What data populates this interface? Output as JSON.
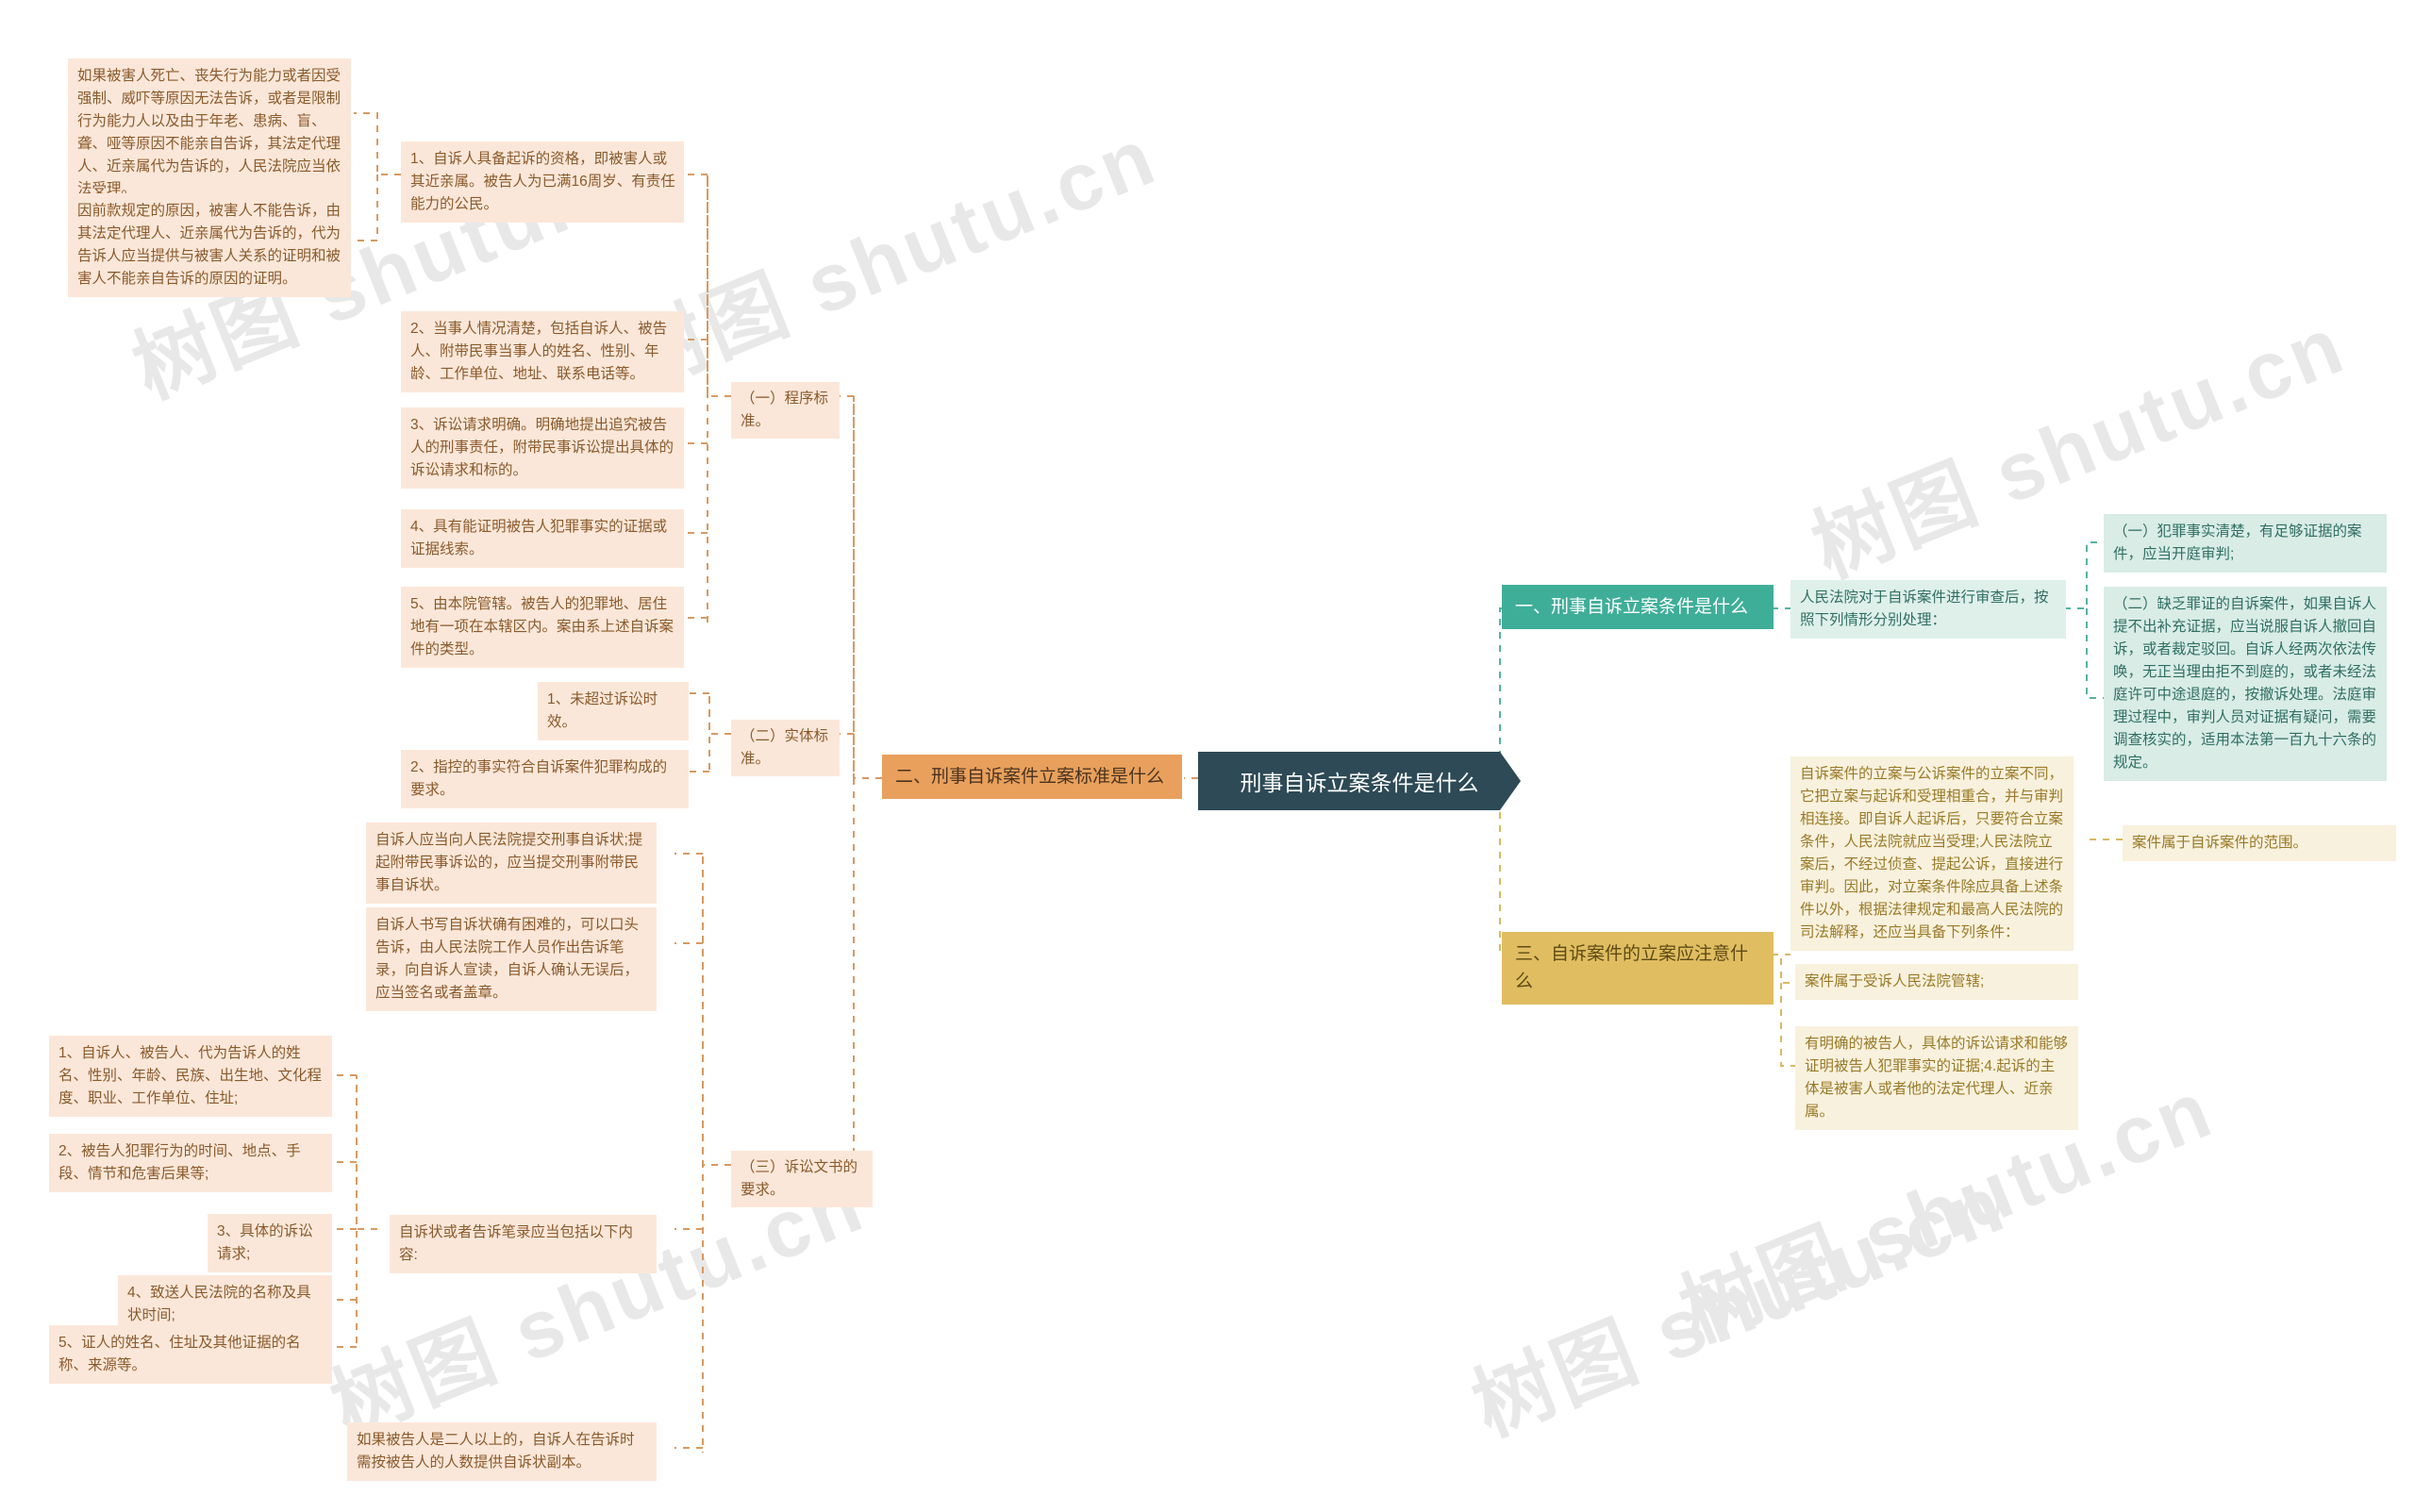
{
  "root": {
    "label": "刑事自诉立案条件是什么"
  },
  "watermarks": [
    "树图 shutu.cn",
    "树图 shutu.cn",
    "树图 shutu.cn",
    "树图 shutu.cn",
    "树图 shutu.cn",
    "树图 shutu.cn"
  ],
  "colors": {
    "root_bg": "#2d4a56",
    "branch_orange": "#e8a05c",
    "branch_mint": "#3fae99",
    "branch_gold": "#e0bd61",
    "leaf_peach": "#fbe7d9",
    "leaf_mint": "#dff0ea",
    "leaf_gold": "#f8f1dd",
    "link_orange": "#d79a62",
    "link_mint": "#55b3a0",
    "link_gold": "#d9b860",
    "text_peach": "#8a5a2b",
    "text_mint": "#2f6f62",
    "text_gold": "#9a7a28"
  },
  "branches": {
    "one": {
      "label": "一、刑事自诉立案条件是什么",
      "intro": "人民法院对于自诉案件进行审查后，按照下列情形分别处理：",
      "items": [
        "（一）犯罪事实清楚，有足够证据的案件，应当开庭审判;",
        "（二）缺乏罪证的自诉案件，如果自诉人提不出补充证据，应当说服自诉人撤回自诉，或者裁定驳回。自诉人经两次依法传唤，无正当理由拒不到庭的，或者未经法庭许可中途退庭的，按撤诉处理。法庭审理过程中，审判人员对证据有疑问，需要调查核实的，适用本法第一百九十六条的规定。"
      ]
    },
    "two": {
      "label": "二、刑事自诉案件立案标准是什么",
      "groups": [
        {
          "label": "（一）程序标准。",
          "items": [
            "1、自诉人具备起诉的资格，即被害人或其近亲属。被告人为已满16周岁、有责任能力的公民。",
            "2、当事人情况清楚，包括自诉人、被告人、附带民事当事人的姓名、性别、年龄、工作单位、地址、联系电话等。",
            "3、诉讼请求明确。明确地提出追究被告人的刑事责任，附带民事诉讼提出具体的诉讼请求和标的。",
            "4、具有能证明被告人犯罪事实的证据或证据线索。",
            "5、由本院管辖。被告人的犯罪地、居住地有一项在本辖区内。案由系上述自诉案件的类型。"
          ],
          "sub_of_item1": [
            "如果被害人死亡、丧失行为能力或者因受强制、威吓等原因无法告诉，或者是限制行为能力人以及由于年老、患病、盲、聋、哑等原因不能亲自告诉，其法定代理人、近亲属代为告诉的，人民法院应当依法受理。",
            "因前款规定的原因，被害人不能告诉，由其法定代理人、近亲属代为告诉的，代为告诉人应当提供与被害人关系的证明和被害人不能亲自告诉的原因的证明。"
          ]
        },
        {
          "label": "（二）实体标准。",
          "items": [
            "1、未超过诉讼时效。",
            "2、指控的事实符合自诉案件犯罪构成的要求。"
          ]
        },
        {
          "label": "（三）诉讼文书的要求。",
          "items": [
            "自诉人应当向人民法院提交刑事自诉状;提起附带民事诉讼的，应当提交刑事附带民事自诉状。",
            "自诉人书写自诉状确有困难的，可以口头告诉，由人民法院工作人员作出告诉笔录，向自诉人宣读，自诉人确认无误后，应当签名或者盖章。",
            "自诉状或者告诉笔录应当包括以下内容:",
            "如果被告人是二人以上的，自诉人在告诉时需按被告人的人数提供自诉状副本。"
          ],
          "contents": [
            "1、自诉人、被告人、代为告诉人的姓名、性别、年龄、民族、出生地、文化程度、职业、工作单位、住址;",
            "2、被告人犯罪行为的时间、地点、手段、情节和危害后果等;",
            "3、具体的诉讼请求;",
            "4、致送人民法院的名称及具状时间;",
            "5、证人的姓名、住址及其他证据的名称、来源等。"
          ]
        }
      ]
    },
    "three": {
      "label": "三、自诉案件的立案应注意什么",
      "intro": "自诉案件的立案与公诉案件的立案不同，它把立案与起诉和受理相重合，并与审判相连接。即自诉人起诉后，只要符合立案条件，人民法院就应当受理;人民法院立案后，不经过侦查、提起公诉，直接进行审判。因此，对立案条件除应具备上述条件以外，根据法律规定和最高人民法院的司法解释，还应当具备下列条件：",
      "items": [
        "案件属于自诉案件的范围。",
        "案件属于受诉人民法院管辖;",
        "有明确的被告人，具体的诉讼请求和能够证明被告人犯罪事实的证据;4.起诉的主体是被害人或者他的法定代理人、近亲属。"
      ]
    }
  }
}
